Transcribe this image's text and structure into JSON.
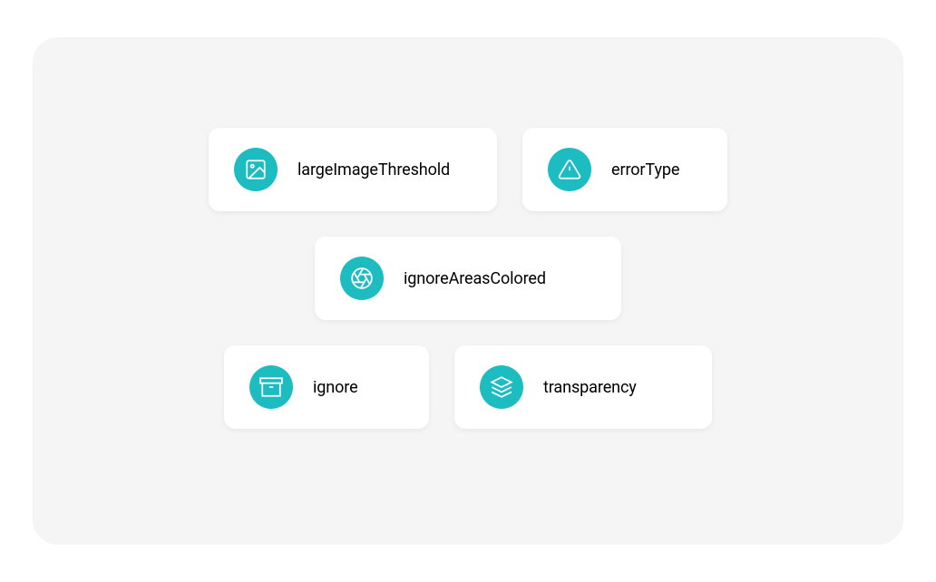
{
  "accent_color": "#1cbcc1",
  "items": {
    "largeImageThreshold": {
      "label": "largeImageThreshold",
      "icon": "image-icon"
    },
    "errorType": {
      "label": "errorType",
      "icon": "alert-triangle-icon"
    },
    "ignoreAreasColored": {
      "label": "ignoreAreasColored",
      "icon": "aperture-icon"
    },
    "ignore": {
      "label": "ignore",
      "icon": "archive-icon"
    },
    "transparency": {
      "label": "transparency",
      "icon": "layers-icon"
    }
  }
}
